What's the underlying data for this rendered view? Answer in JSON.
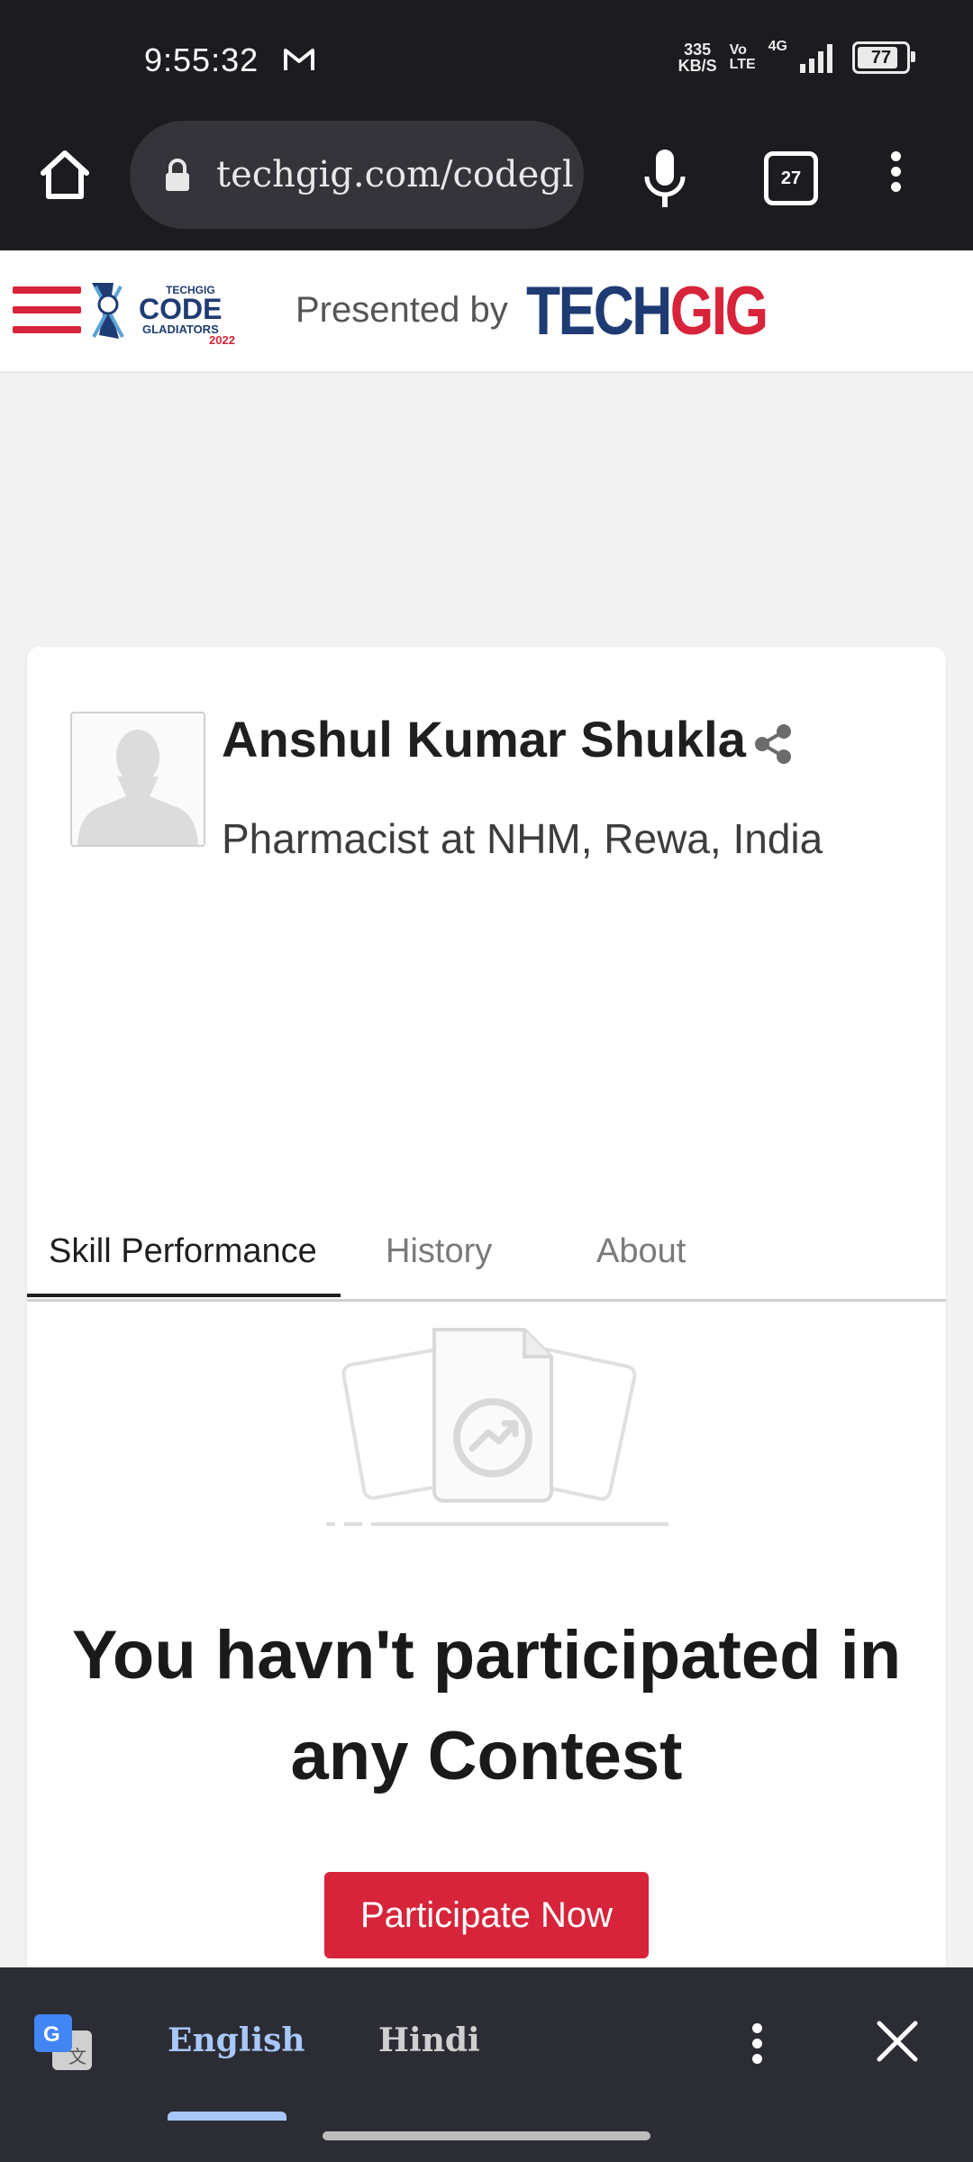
{
  "status_bar": {
    "time": "9:55:32",
    "net_speed_value": "335",
    "net_speed_unit": "KB/S",
    "volte_top": "Vo",
    "volte_bottom": "LTE",
    "network": "4G",
    "battery": "77",
    "icons": [
      "gmail-icon",
      "signal-icon",
      "battery-icon"
    ]
  },
  "browser": {
    "url": "techgig.com/codegl",
    "tab_count": "27",
    "icons": [
      "home-icon",
      "lock-icon",
      "mic-icon",
      "tabs-icon",
      "menu-icon"
    ]
  },
  "site_header": {
    "presented_by": "Presented by",
    "brand_tech": "TECH",
    "brand_gig": "GIG",
    "logo_top": "TECHGIG",
    "logo_main": "CODE",
    "logo_sub": "GLADIATORS",
    "logo_year": "2022"
  },
  "profile": {
    "name": "Anshul Kumar Shukla",
    "role": "Pharmacist at NHM, Rewa, India"
  },
  "tabs": [
    {
      "label": "Skill Performance",
      "active": true
    },
    {
      "label": "History",
      "active": false
    },
    {
      "label": "About",
      "active": false
    }
  ],
  "empty_state": {
    "line1": "You havn't participated in",
    "line2": "any Contest",
    "button": "Participate Now"
  },
  "translate": {
    "languages": [
      "English",
      "Hindi"
    ],
    "selected": "English"
  },
  "colors": {
    "accent": "#d7243a",
    "brand_blue": "#1f3b73",
    "dark_bar": "#1c1b1f",
    "translate_bar": "#2b2c34"
  }
}
